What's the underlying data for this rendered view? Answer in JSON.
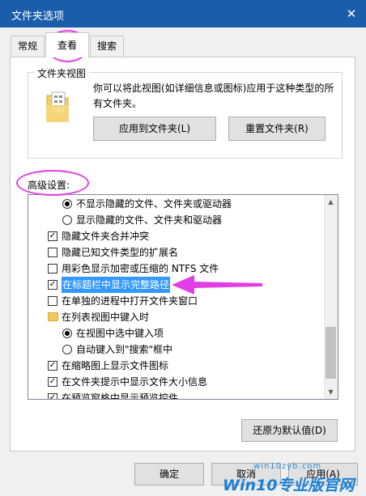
{
  "window": {
    "title": "文件夹选项",
    "close_glyph": "✕"
  },
  "tabs": [
    "常规",
    "查看",
    "搜索"
  ],
  "folder_view": {
    "title": "文件夹视图",
    "description": "你可以将此视图(如详细信息或图标)应用于这种类型的所有文件夹。",
    "apply_label": "应用到文件夹(L)",
    "reset_label": "重置文件夹(R)"
  },
  "advanced": {
    "label": "高级设置:",
    "items": [
      {
        "type": "radio",
        "checked": true,
        "indent": 2,
        "label": "不显示隐藏的文件、文件夹或驱动器"
      },
      {
        "type": "radio",
        "checked": false,
        "indent": 2,
        "label": "显示隐藏的文件、文件夹和驱动器"
      },
      {
        "type": "checkbox",
        "checked": true,
        "indent": 1,
        "label": "隐藏文件夹合并冲突"
      },
      {
        "type": "checkbox",
        "checked": false,
        "indent": 1,
        "label": "隐藏已知文件类型的扩展名"
      },
      {
        "type": "checkbox",
        "checked": false,
        "indent": 1,
        "label": "用彩色显示加密或压缩的 NTFS 文件"
      },
      {
        "type": "checkbox",
        "checked": true,
        "indent": 1,
        "label": "在标题栏中显示完整路径",
        "highlighted": true
      },
      {
        "type": "checkbox",
        "checked": false,
        "indent": 1,
        "label": "在单独的进程中打开文件夹窗口"
      },
      {
        "type": "folder",
        "indent": 1,
        "label": "在列表视图中键入时"
      },
      {
        "type": "radio",
        "checked": true,
        "indent": 2,
        "label": "在视图中选中键入项"
      },
      {
        "type": "radio",
        "checked": false,
        "indent": 2,
        "label": "自动键入到\"搜索\"框中"
      },
      {
        "type": "checkbox",
        "checked": true,
        "indent": 1,
        "label": "在缩略图上显示文件图标"
      },
      {
        "type": "checkbox",
        "checked": true,
        "indent": 1,
        "label": "在文件夹提示中显示文件大小信息"
      },
      {
        "type": "checkbox",
        "checked": true,
        "indent": 1,
        "label": "在预览窗格中显示预览控件"
      }
    ]
  },
  "buttons": {
    "restore_defaults": "还原为默认值(D)",
    "ok": "确定",
    "cancel": "取消",
    "apply": "应用(A)"
  },
  "watermark": {
    "url": "win10zyb.com",
    "brand": "Win10专业版官网"
  },
  "colors": {
    "titlebar": "#1a5dab",
    "selection": "#3399ff",
    "annotation": "#e13fe6"
  },
  "icons": [
    "close-icon",
    "folder-view-icon",
    "scroll-up-icon",
    "scroll-down-icon",
    "folder-icon",
    "annotation-arrow"
  ]
}
